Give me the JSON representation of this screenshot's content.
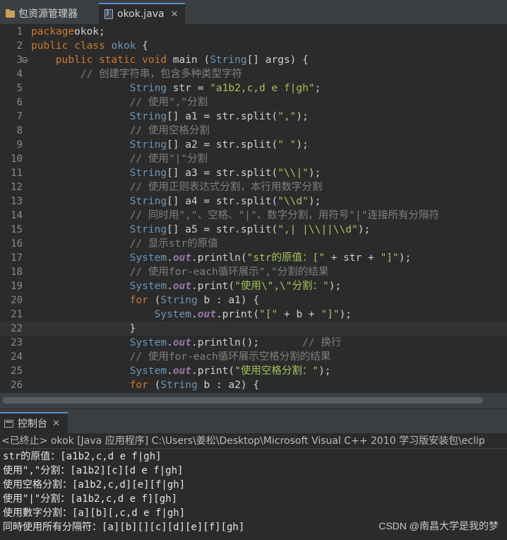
{
  "tabs": [
    {
      "label": "包资源管理器",
      "icon": "package-explorer-icon"
    },
    {
      "label": "okok.java",
      "icon": "java-file-icon",
      "close": "✕"
    }
  ],
  "editor": {
    "lines": [
      {
        "n": "1",
        "code": [
          [
            "kw",
            "package"
          ],
          [
            "",
            "okok;"
          ]
        ]
      },
      {
        "n": "2",
        "code": [
          [
            "kw",
            "public class "
          ],
          [
            "ty",
            "okok"
          ],
          [
            "",
            " {"
          ]
        ]
      },
      {
        "n": "3",
        "code": [
          [
            "",
            "    "
          ],
          [
            "kw",
            "public static void "
          ],
          [
            "",
            "main ("
          ],
          [
            "ty",
            "String"
          ],
          [
            "",
            "[] args) {"
          ]
        ]
      },
      {
        "n": "4",
        "code": [
          [
            "",
            "        "
          ],
          [
            "cm",
            "// 创建字符串，包含多种类型字符"
          ]
        ]
      },
      {
        "n": "5",
        "code": [
          [
            "",
            "                "
          ],
          [
            "ty",
            "String"
          ],
          [
            "",
            " str = "
          ],
          [
            "st",
            "\"a1b2,c,d e f|gh\""
          ],
          [
            "",
            ";"
          ]
        ]
      },
      {
        "n": "6",
        "code": [
          [
            "",
            "                "
          ],
          [
            "cm",
            "// 使用\",\"分割"
          ]
        ]
      },
      {
        "n": "7",
        "code": [
          [
            "",
            "                "
          ],
          [
            "ty",
            "String"
          ],
          [
            "",
            "[] a1 = str.split("
          ],
          [
            "st",
            "\",\""
          ],
          [
            "",
            ");"
          ]
        ]
      },
      {
        "n": "8",
        "code": [
          [
            "",
            "                "
          ],
          [
            "cm",
            "// 使用空格分割"
          ]
        ]
      },
      {
        "n": "9",
        "code": [
          [
            "",
            "                "
          ],
          [
            "ty",
            "String"
          ],
          [
            "",
            "[] a2 = str.split("
          ],
          [
            "st",
            "\" \""
          ],
          [
            "",
            ");"
          ]
        ]
      },
      {
        "n": "10",
        "code": [
          [
            "",
            "                "
          ],
          [
            "cm",
            "// 使用\"|\"分割"
          ]
        ]
      },
      {
        "n": "11",
        "code": [
          [
            "",
            "                "
          ],
          [
            "ty",
            "String"
          ],
          [
            "",
            "[] a3 = str.split("
          ],
          [
            "st",
            "\"\\\\|\""
          ],
          [
            "",
            ");"
          ]
        ]
      },
      {
        "n": "12",
        "code": [
          [
            "",
            "                "
          ],
          [
            "cm",
            "// 使用正则表达式分割，本行用数字分割"
          ]
        ]
      },
      {
        "n": "13",
        "code": [
          [
            "",
            "                "
          ],
          [
            "ty",
            "String"
          ],
          [
            "",
            "[] a4 = str.split("
          ],
          [
            "st",
            "\"\\\\d\""
          ],
          [
            "",
            ");"
          ]
        ]
      },
      {
        "n": "14",
        "code": [
          [
            "",
            "                "
          ],
          [
            "cm",
            "// 同时用\",\"、空格、\"|\"、数字分割，用符号\"|\"连接所有分隔符"
          ]
        ]
      },
      {
        "n": "15",
        "code": [
          [
            "",
            "                "
          ],
          [
            "ty",
            "String"
          ],
          [
            "",
            "[] a5 = str.split("
          ],
          [
            "st",
            "\",| |\\\\||\\\\d\""
          ],
          [
            "",
            ");"
          ]
        ]
      },
      {
        "n": "16",
        "code": [
          [
            "",
            "                "
          ],
          [
            "cm",
            "// 显示str的原值"
          ]
        ]
      },
      {
        "n": "17",
        "code": [
          [
            "",
            "                "
          ],
          [
            "ty",
            "System"
          ],
          [
            "",
            "."
          ],
          [
            "fld",
            "out"
          ],
          [
            "",
            ".println("
          ],
          [
            "st",
            "\"str的原值：[\""
          ],
          [
            "",
            " + str + "
          ],
          [
            "st",
            "\"]\""
          ],
          [
            "",
            ");"
          ]
        ]
      },
      {
        "n": "18",
        "code": [
          [
            "",
            "                "
          ],
          [
            "cm",
            "// 使用for-each循环展示\",\"分割的结果"
          ]
        ]
      },
      {
        "n": "19",
        "code": [
          [
            "",
            "                "
          ],
          [
            "ty",
            "System"
          ],
          [
            "",
            "."
          ],
          [
            "fld",
            "out"
          ],
          [
            "",
            ".print("
          ],
          [
            "st",
            "\"使用\\\",\\\"分割：\""
          ],
          [
            "",
            ");"
          ]
        ]
      },
      {
        "n": "20",
        "code": [
          [
            "",
            "                "
          ],
          [
            "kw",
            "for"
          ],
          [
            "",
            " ("
          ],
          [
            "ty",
            "String"
          ],
          [
            "",
            " b : a1) {"
          ]
        ]
      },
      {
        "n": "21",
        "code": [
          [
            "",
            "                    "
          ],
          [
            "ty",
            "System"
          ],
          [
            "",
            "."
          ],
          [
            "fld",
            "out"
          ],
          [
            "",
            ".print("
          ],
          [
            "st",
            "\"[\""
          ],
          [
            "",
            " + b + "
          ],
          [
            "st",
            "\"]\""
          ],
          [
            "",
            ");"
          ]
        ]
      },
      {
        "n": "22",
        "code": [
          [
            "",
            "                }"
          ]
        ]
      },
      {
        "n": "23",
        "code": [
          [
            "",
            "                "
          ],
          [
            "ty",
            "System"
          ],
          [
            "",
            "."
          ],
          [
            "fld",
            "out"
          ],
          [
            "",
            ".println();       "
          ],
          [
            "cm",
            "// 换行"
          ]
        ]
      },
      {
        "n": "24",
        "code": [
          [
            "",
            "                "
          ],
          [
            "cm",
            "// 使用for-each循环展示空格分割的结果"
          ]
        ]
      },
      {
        "n": "25",
        "code": [
          [
            "",
            "                "
          ],
          [
            "ty",
            "System"
          ],
          [
            "",
            "."
          ],
          [
            "fld",
            "out"
          ],
          [
            "",
            ".print("
          ],
          [
            "st",
            "\"使用空格分割：\""
          ],
          [
            "",
            ");"
          ]
        ]
      },
      {
        "n": "26",
        "code": [
          [
            "",
            "                "
          ],
          [
            "kw",
            "for"
          ],
          [
            "",
            " ("
          ],
          [
            "ty",
            "String"
          ],
          [
            "",
            " b : a2) {"
          ]
        ]
      }
    ]
  },
  "console": {
    "tab_label": "控制台",
    "tab_close": "✕",
    "context": "<已终止> okok [Java 应用程序] C:\\Users\\姜松\\Desktop\\Microsoft Visual C++ 2010 学习版安装包\\eclip",
    "output": [
      "str的原值：[a1b2,c,d e f|gh]",
      "使用\",\"分割：[a1b2][c][d e f|gh]",
      "使用空格分割：[a1b2,c,d][e][f|gh]",
      "使用\"|\"分割：[a1b2,c,d e f][gh]",
      "使用數字分割：[a][b][,c,d e f|gh]",
      "同時使用所有分隔符：[a][b][][c][d][e][f][gh]"
    ]
  },
  "watermark": "CSDN @南昌大学是我的梦",
  "colors": {
    "keyword": "#cc7832",
    "type": "#6897bb",
    "string": "#a5c25c",
    "comment": "#808080",
    "field": "#9876aa"
  }
}
